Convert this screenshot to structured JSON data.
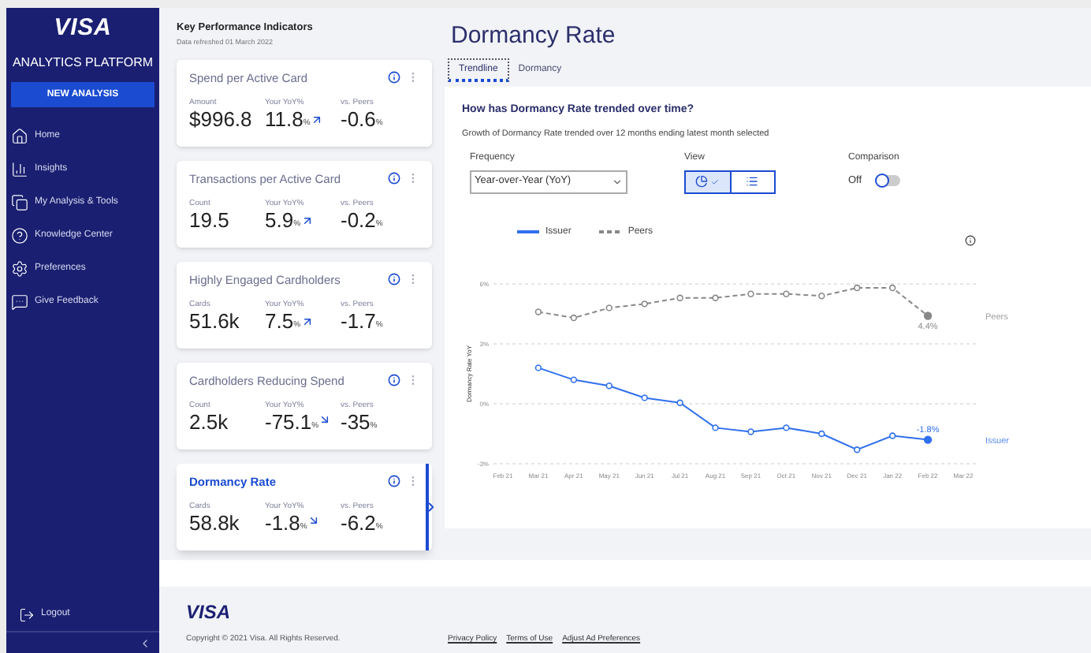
{
  "sidebar": {
    "logo": "VISA",
    "title": "ANALYTICS PLATFORM",
    "new_button": "NEW ANALYSIS",
    "items": [
      {
        "label": "Home",
        "kind": "home"
      },
      {
        "label": "Insights",
        "kind": "insights"
      },
      {
        "label": "My Analysis & Tools",
        "kind": "tools"
      },
      {
        "label": "Knowledge Center",
        "kind": "help"
      },
      {
        "label": "Preferences",
        "kind": "settings"
      },
      {
        "label": "Give Feedback",
        "kind": "feedback"
      }
    ],
    "logout": "Logout"
  },
  "kpi": {
    "title": "Key Performance Indicators",
    "subtitle": "Data refreshed 01 March 2022",
    "cards": [
      {
        "title": "Spend per Active Card",
        "selected": false,
        "primary": {
          "label": "Amount",
          "value": "$996.8"
        },
        "yoy": {
          "label": "Your YoY%",
          "value": "11.8",
          "unit": "%",
          "kind": "up"
        },
        "peers": {
          "label": "vs. Peers",
          "value": "-0.6",
          "unit": "%"
        }
      },
      {
        "title": "Transactions per Active Card",
        "selected": false,
        "primary": {
          "label": "Count",
          "value": "19.5"
        },
        "yoy": {
          "label": "Your YoY%",
          "value": "5.9",
          "unit": "%",
          "kind": "up"
        },
        "peers": {
          "label": "vs. Peers",
          "value": "-0.2",
          "unit": "%"
        }
      },
      {
        "title": "Highly Engaged Cardholders",
        "selected": false,
        "primary": {
          "label": "Cards",
          "value": "51.6k"
        },
        "yoy": {
          "label": "Your YoY%",
          "value": "7.5",
          "unit": "%",
          "kind": "up"
        },
        "peers": {
          "label": "vs. Peers",
          "value": "-1.7",
          "unit": "%"
        }
      },
      {
        "title": "Cardholders Reducing Spend",
        "selected": false,
        "primary": {
          "label": "Count",
          "value": "2.5k"
        },
        "yoy": {
          "label": "Your YoY%",
          "value": "-75.1",
          "unit": "%",
          "kind": "down"
        },
        "peers": {
          "label": "vs. Peers",
          "value": "-35",
          "unit": "%"
        }
      },
      {
        "title": "Dormancy Rate",
        "selected": true,
        "primary": {
          "label": "Cards",
          "value": "58.8k"
        },
        "yoy": {
          "label": "Your YoY%",
          "value": "-1.8",
          "unit": "%",
          "kind": "down"
        },
        "peers": {
          "label": "vs. Peers",
          "value": "-6.2",
          "unit": "%"
        }
      }
    ]
  },
  "detail": {
    "title": "Dormancy Rate",
    "tabs": [
      {
        "label": "Trendline",
        "selected": true
      },
      {
        "label": "Dormancy",
        "selected": false
      }
    ],
    "question": "How has Dormancy Rate trended over time?",
    "description": "Growth of Dormancy Rate trended over 12 months ending latest month selected",
    "frequency": {
      "label": "Frequency",
      "value": "Year-over-Year (YoY)"
    },
    "view": {
      "label": "View",
      "options": [
        {
          "kind": "chart",
          "selected": true
        },
        {
          "kind": "list",
          "selected": false
        }
      ]
    },
    "comparison": {
      "label": "Comparison",
      "state_label": "Off",
      "on": false
    },
    "chart_data": {
      "type": "line",
      "ylabel": "Dormancy Rate YoY",
      "categories": [
        "Feb 21",
        "Mar 21",
        "Apr 21",
        "May 21",
        "Jun 21",
        "Jul 21",
        "Aug 21",
        "Sep 21",
        "Oct 21",
        "Nov 21",
        "Dec 21",
        "Jan 22",
        "Feb 22",
        "Mar 22"
      ],
      "series": [
        {
          "name": "Issuer",
          "color": "#2f6fed",
          "line_style": "solid",
          "marker": "circle",
          "values": [
            null,
            1.8,
            1.2,
            0.9,
            0.3,
            0.05,
            -1.2,
            -1.4,
            -1.2,
            -1.5,
            -2.3,
            -1.6,
            -1.8,
            null
          ]
        },
        {
          "name": "Peers",
          "color": "#888888",
          "line_style": "dashed",
          "marker": "circle",
          "values": [
            null,
            4.6,
            4.3,
            4.8,
            5.0,
            5.3,
            5.3,
            5.5,
            5.5,
            5.4,
            5.8,
            5.8,
            4.4,
            null
          ]
        }
      ],
      "ylim": [
        -3,
        6
      ],
      "yticks": [
        {
          "value": 6,
          "label": "6%"
        },
        {
          "value": 3,
          "label": "3%"
        },
        {
          "value": 0,
          "label": "0%"
        },
        {
          "value": -3,
          "label": "-3%"
        }
      ],
      "annotations": [
        "-1.8%",
        "4.4%"
      ]
    }
  },
  "footer": {
    "logo": "VISA",
    "copyright": "Copyright © 2021 Visa. All Rights Reserved.",
    "links": [
      "Privacy Policy",
      "Terms of Use",
      "Adjust Ad Preferences"
    ]
  }
}
